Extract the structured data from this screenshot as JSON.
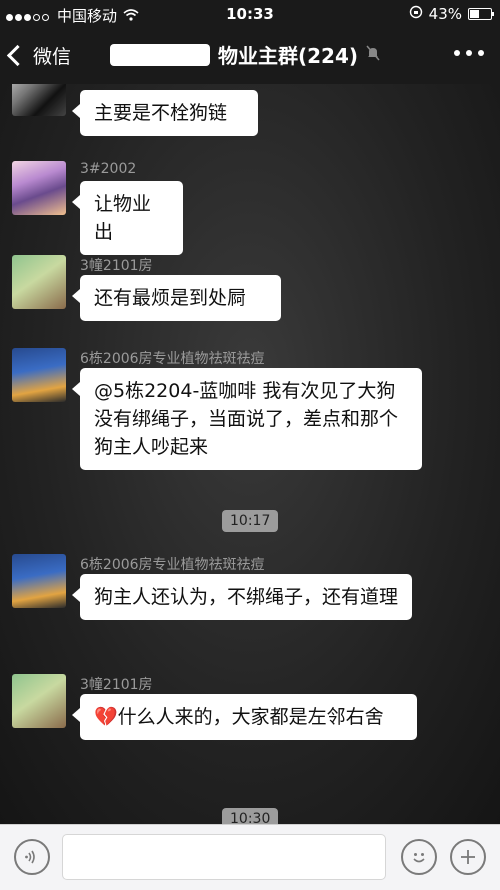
{
  "status_bar": {
    "carrier": "中国移动",
    "time": "10:33",
    "battery": "43%",
    "battery_level": 0.43,
    "icons": [
      "signal-icon",
      "wifi-icon",
      "rotation-lock-icon",
      "battery-icon"
    ]
  },
  "nav": {
    "back_label": "微信",
    "title_suffix": "物业主群(224)",
    "icons": [
      "chevron-left-icon",
      "mute-icon",
      "more-icon"
    ]
  },
  "messages": [
    {
      "sender": "",
      "text": "主要是不栓狗链",
      "avatar": "dark-portrait"
    },
    {
      "sender": "3#2002",
      "text": "让物业出",
      "avatar": "anime-girl"
    },
    {
      "sender": "3幢2101房",
      "text": "还有最烦是到处屙",
      "avatar": "green-drawing"
    },
    {
      "sender": "6栋2006房专业植物祛斑祛痘",
      "text": "@5栋2204-蓝咖啡 我有次见了大狗没有绑绳子，当面说了，差点和那个狗主人吵起来",
      "avatar": "city-night"
    },
    {
      "sender": "6栋2006房专业植物祛斑祛痘",
      "text": "狗主人还认为，不绑绳子，还有道理",
      "avatar": "city-night"
    },
    {
      "sender": "3幢2101房",
      "emoji": "💔",
      "text": "什么人来的，大家都是左邻右舍",
      "avatar": "green-drawing"
    }
  ],
  "time_dividers": [
    "10:17",
    "10:30"
  ],
  "input_bar": {
    "icons": [
      "voice-icon",
      "emoji-icon",
      "plus-icon"
    ],
    "placeholder": ""
  },
  "colors": {
    "bubble": "#ffffff",
    "bar_bg": "#1a1a1a",
    "input_bg": "#f4f4f6"
  }
}
